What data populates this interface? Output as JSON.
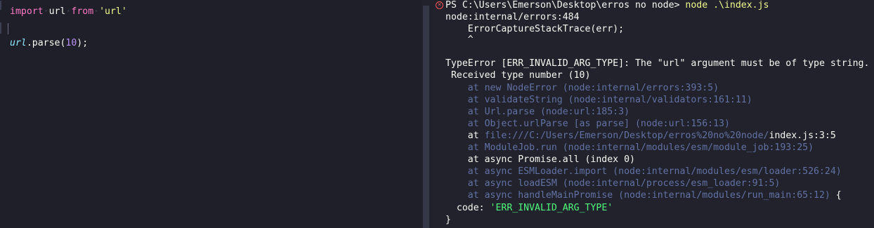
{
  "editor": {
    "line1": {
      "kw_import": "import",
      "ident": "url",
      "kw_from": "from",
      "string": "'url'"
    },
    "line3": {
      "var": "url",
      "dot_fn": ".parse(",
      "num": "10",
      "end": ");"
    }
  },
  "terminal": {
    "prompt": "PS C:\\Users\\Emerson\\Desktop\\erros no node> ",
    "command": "node .\\index.js",
    "lines": [
      "node:internal/errors:484",
      "    ErrorCaptureStackTrace(err);",
      "    ^",
      "TypeError [ERR_INVALID_ARG_TYPE]: The \"url\" argument must be of type string.",
      " Received type number (10)",
      "    at new NodeError (node:internal/errors:393:5)",
      "    at validateString (node:internal/validators:161:11)",
      "    at Url.parse (node:url:185:3)",
      "    at Object.urlParse [as parse] (node:url:156:13)"
    ],
    "file_frame": {
      "at": "    at ",
      "path": "file:///C:/Users/Emerson/Desktop/erros%20no%20node/",
      "file": "index.js:3:5"
    },
    "module_job": "    at ModuleJob.run (node:internal/modules/esm/module_job:193:25)",
    "promise_all": "    at async Promise.all (index 0)",
    "esm_import": "    at async ESMLoader.import (node:internal/modules/esm/loader:526:24)",
    "load_esm": "    at async loadESM (node:internal/process/esm_loader:91:5)",
    "handle_main": "    at async handleMainPromise (node:internal/modules/run_main:65:12)",
    "handle_main_brace": " {",
    "code_key": "  code: ",
    "code_value": "'ERR_INVALID_ARG_TYPE'",
    "close_brace": "}"
  },
  "colors": {
    "background": "#21222c",
    "keyword": "#ff79c6",
    "string": "#f1fa8c",
    "number": "#bd93f9",
    "variable": "#8be9fd",
    "dim": "#6272a4",
    "green": "#50fa7b",
    "error": "#ff5555"
  },
  "icons": {
    "error_status": "error-circle-icon"
  }
}
